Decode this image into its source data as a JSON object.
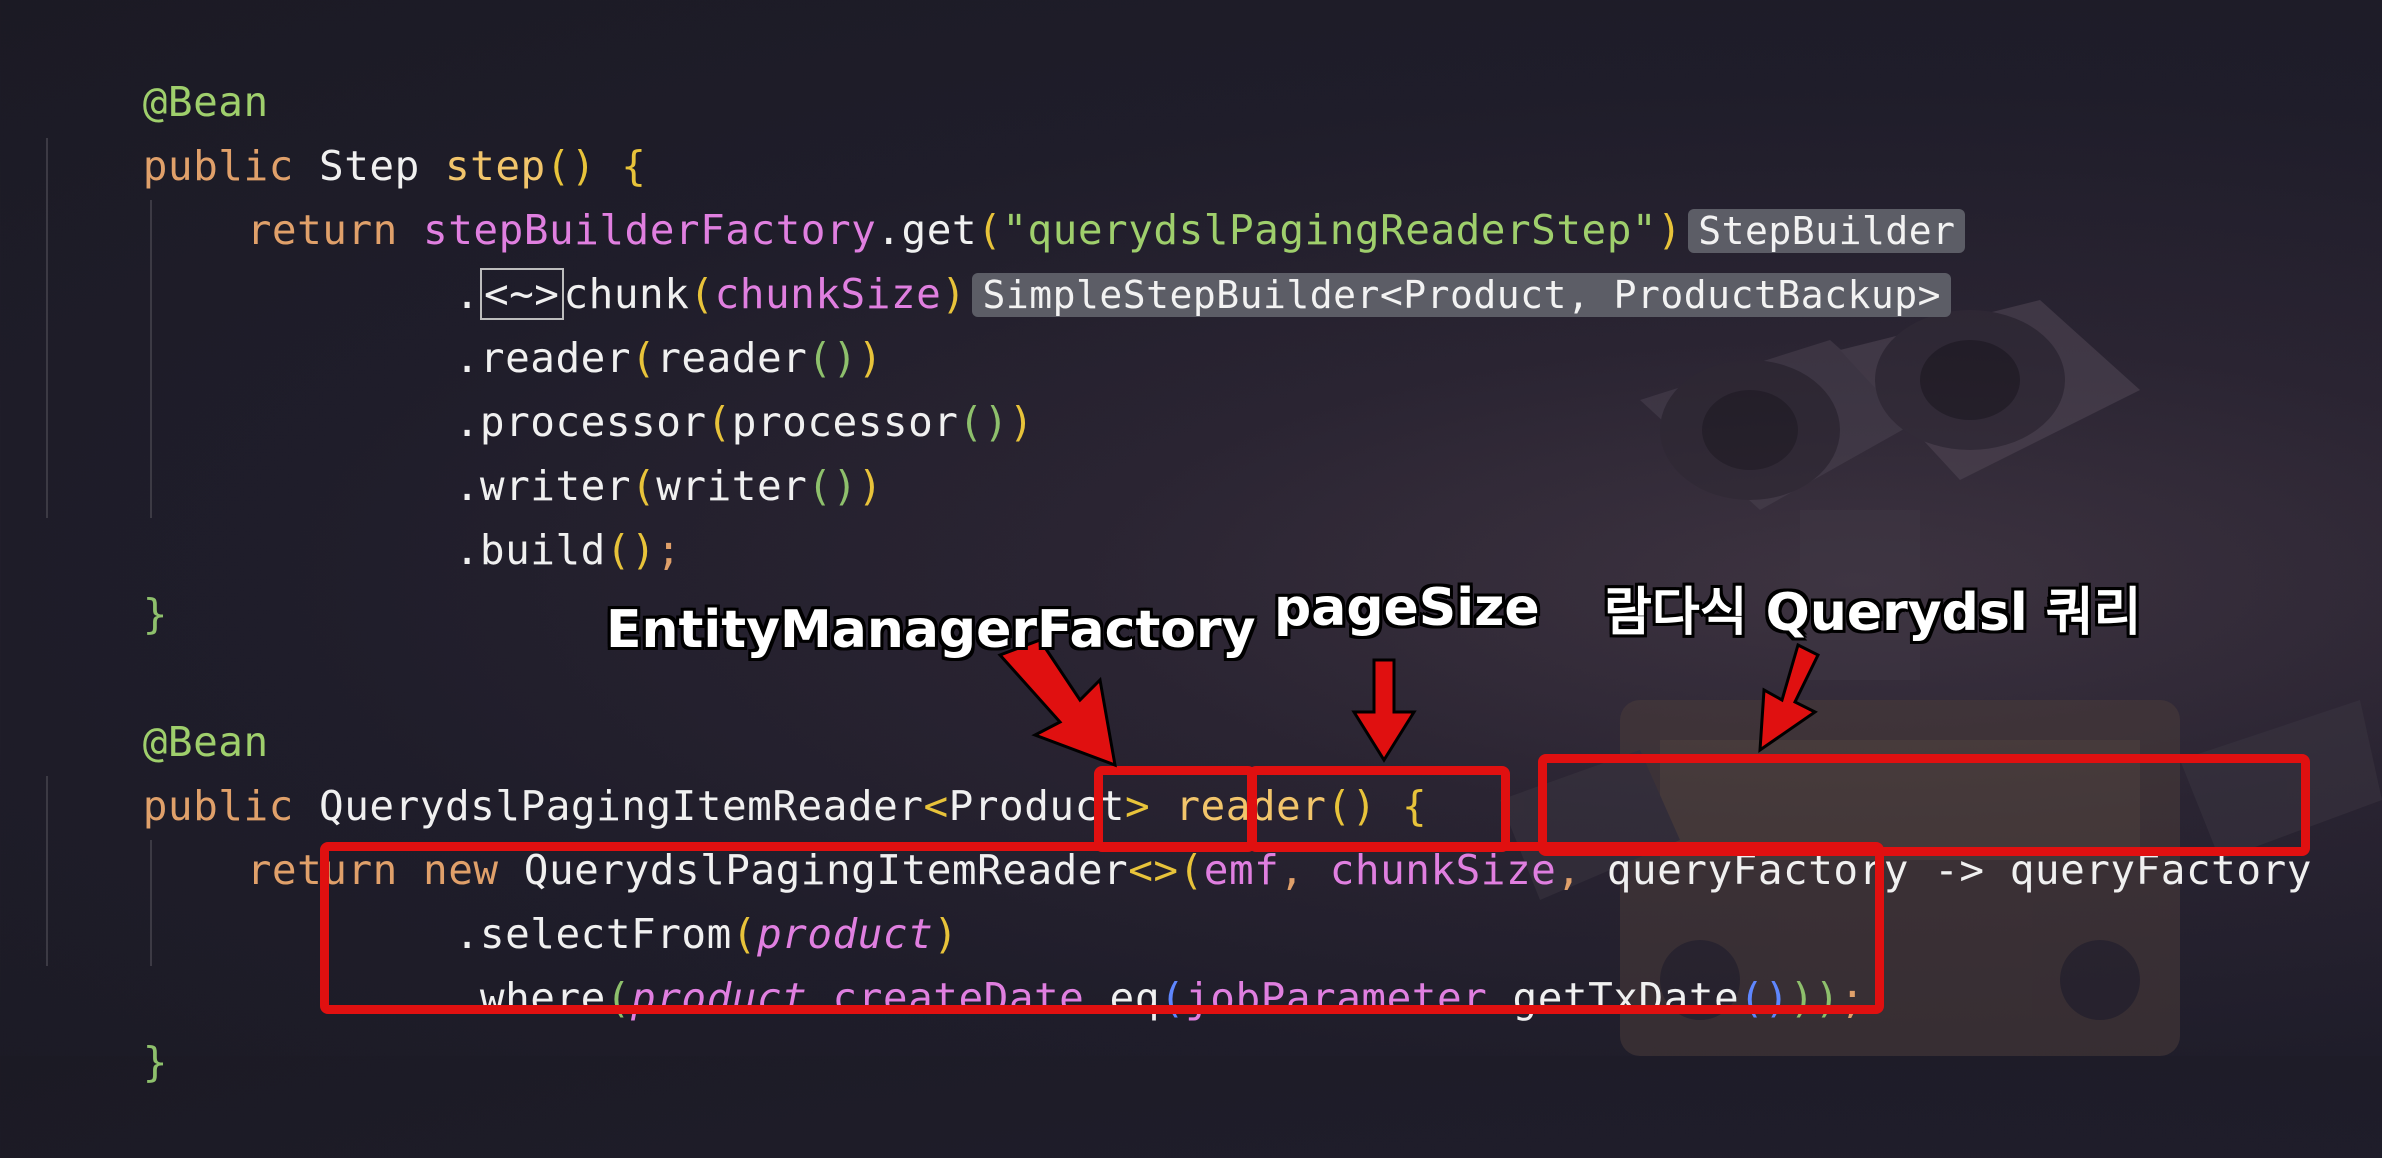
{
  "code": {
    "line1": {
      "annotation": "@Bean"
    },
    "line2": {
      "kw": "public",
      "type": " Step ",
      "name": "step",
      "paren": "()",
      "brace": " {"
    },
    "line3": {
      "kw": "return",
      "factory": "stepBuilderFactory",
      "get": ".get",
      "open": "(",
      "str": "\"querydslPagingReaderStep\"",
      "close": ")",
      "hint": "StepBuilder"
    },
    "line4": {
      "dot": ".",
      "diamond": "<~>",
      "method": "chunk",
      "open": "(",
      "arg": "chunkSize",
      "close": ")",
      "hint": "SimpleStepBuilder<Product, ProductBackup>"
    },
    "line5": {
      "method": ".reader",
      "open": "(",
      "arg": "reader",
      "inner": "()",
      "close": ")"
    },
    "line6": {
      "method": ".processor",
      "open": "(",
      "arg": "processor",
      "inner": "()",
      "close": ")"
    },
    "line7": {
      "method": ".writer",
      "open": "(",
      "arg": "writer",
      "inner": "()",
      "close": ")"
    },
    "line8": {
      "method": ".build",
      "paren": "()",
      "semi": ";"
    },
    "line9": {
      "brace": "}"
    },
    "line10": {
      "annotation": "@Bean"
    },
    "line11": {
      "kw": "public",
      "type": " QuerydslPagingItemReader",
      "lt": "<",
      "generic": "Product",
      "gt": ">",
      "name": " reader",
      "paren": "()",
      "brace": " {"
    },
    "line12": {
      "kw": "return new",
      "type": " QuerydslPagingItemReader",
      "diamond": "<>",
      "open": "(",
      "emf": "emf",
      "comma1": ", ",
      "chunk": "chunkSize",
      "comma2": ", ",
      "lambda": "queryFactory -> queryFactory"
    },
    "line13": {
      "method": ".selectFrom",
      "open": "(",
      "arg": "product",
      "close": ")"
    },
    "line14": {
      "method": ".where",
      "open": "(",
      "product": "product",
      "field": ".createDate",
      "eq": ".eq",
      "open2": "(",
      "jp": "jobParameter",
      "call": ".getTxDate",
      "paren": "()",
      "close": "))",
      "semi": ";"
    },
    "line15": {
      "brace": "}"
    }
  },
  "labels": {
    "emf": "EntityManagerFactory",
    "page_size": "pageSize",
    "lambda": "람다식 Querydsl 쿼리"
  },
  "colors": {
    "highlight": "#e01010",
    "background": "#1e1c28"
  },
  "icons": {
    "background_art": "robot-illustration"
  }
}
